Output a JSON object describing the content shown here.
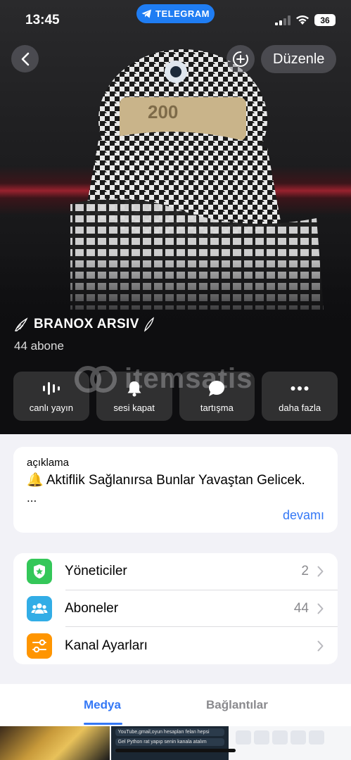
{
  "status_bar": {
    "time": "13:45",
    "app_pill": "TELEGRAM",
    "battery": "36"
  },
  "nav": {
    "back_icon": "chevron-left-icon",
    "add_icon": "add-circle-icon",
    "edit_label": "Düzenle"
  },
  "channel": {
    "name": "BRANOX ARSIV",
    "subscribers": "44 abone"
  },
  "watermark": "itemsatis",
  "actions": [
    {
      "label": "canlı yayın",
      "icon": "live-waveform-icon"
    },
    {
      "label": "sesi kapat",
      "icon": "bell-icon"
    },
    {
      "label": "tartışma",
      "icon": "chat-bubble-icon"
    },
    {
      "label": "daha fazla",
      "icon": "more-dots-icon"
    }
  ],
  "description": {
    "label": "açıklama",
    "text": "🔔 Aktiflik Sağlanırsa Bunlar Yavaştan Gelicek.",
    "ellipsis": "...",
    "more": "devamı"
  },
  "settings": [
    {
      "label": "Yöneticiler",
      "count": "2",
      "icon": "admin-shield-icon",
      "color": "#34c759"
    },
    {
      "label": "Aboneler",
      "count": "44",
      "icon": "people-icon",
      "color": "#32ade6"
    },
    {
      "label": "Kanal Ayarları",
      "count": "",
      "icon": "sliders-icon",
      "color": "#ff9500"
    }
  ],
  "tabs": {
    "media": "Medya",
    "links": "Bağlantılar"
  },
  "media_thumbs": {
    "chat_line_1": "YouTube,gmail,oyun hesapları felan hepsi",
    "chat_line_2": "Gel Python rat yapıp senin kanala atalım"
  },
  "colors": {
    "accent": "#3478f6",
    "telegram_pill": "#1f7df3"
  }
}
